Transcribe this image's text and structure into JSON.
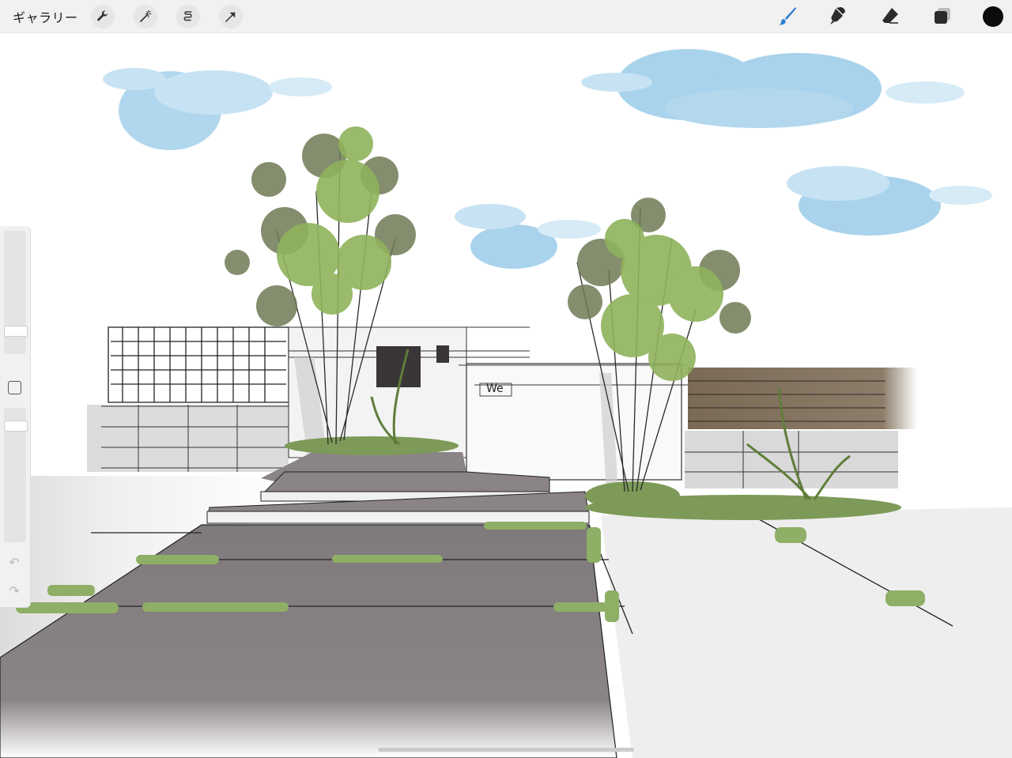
{
  "toolbar": {
    "gallery_label": "ギャラリー",
    "left_tools": [
      {
        "icon": "wrench-icon",
        "name": "actions"
      },
      {
        "icon": "magic-wand-icon",
        "name": "adjustments"
      },
      {
        "icon": "selection-icon",
        "name": "selection"
      },
      {
        "icon": "transform-arrow-icon",
        "name": "transform"
      }
    ],
    "right_tools": [
      {
        "icon": "brush-icon",
        "name": "brush",
        "active": true
      },
      {
        "icon": "smudge-icon",
        "name": "smudge",
        "active": false
      },
      {
        "icon": "eraser-icon",
        "name": "eraser",
        "active": false
      },
      {
        "icon": "layers-icon",
        "name": "layers",
        "active": false
      }
    ],
    "current_color": "#0c0c0c",
    "active_color": "#2f7fd1"
  },
  "sidebar": {
    "brush_size": 0.82,
    "opacity": 0.9,
    "modify_icon": "square-icon",
    "undo_icon": "undo-icon",
    "redo_icon": "redo-icon"
  },
  "canvas": {
    "label_sign": "We",
    "colors": {
      "sky": "#a9d3ec",
      "tree_dark": "#6f7a55",
      "tree_light": "#8fb25c",
      "paving": "#8a8486",
      "fence_wood": "#7a6a55",
      "wall": "#f7f7f7",
      "mailbox": "#3a3536"
    }
  }
}
